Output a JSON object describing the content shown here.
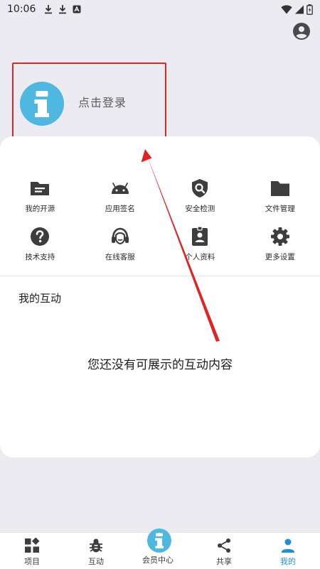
{
  "status_bar": {
    "time": "10:06"
  },
  "header": {
    "login_text": "点击登录"
  },
  "features": [
    {
      "label": "我的开源",
      "icon": "folder-open-icon"
    },
    {
      "label": "应用签名",
      "icon": "android-icon"
    },
    {
      "label": "安全检测",
      "icon": "shield-search-icon"
    },
    {
      "label": "文件管理",
      "icon": "folder-icon"
    },
    {
      "label": "技术支持",
      "icon": "help-icon"
    },
    {
      "label": "在线客服",
      "icon": "headset-icon"
    },
    {
      "label": "个人资料",
      "icon": "badge-icon"
    },
    {
      "label": "更多设置",
      "icon": "gear-icon"
    }
  ],
  "interaction": {
    "title": "我的互动",
    "empty_text": "您还没有可展示的互动内容"
  },
  "bottom_nav": {
    "items": [
      {
        "label": "项目",
        "icon": "widgets-icon"
      },
      {
        "label": "互动",
        "icon": "bug-icon"
      },
      {
        "label": "会员中心",
        "icon": "info-badge-icon"
      },
      {
        "label": "共享",
        "icon": "share-icon"
      },
      {
        "label": "我的",
        "icon": "person-icon"
      }
    ],
    "active_index": 4
  },
  "colors": {
    "accent": "#1f8fd6",
    "avatar": "#4fb8e0",
    "highlight": "#e02424"
  }
}
